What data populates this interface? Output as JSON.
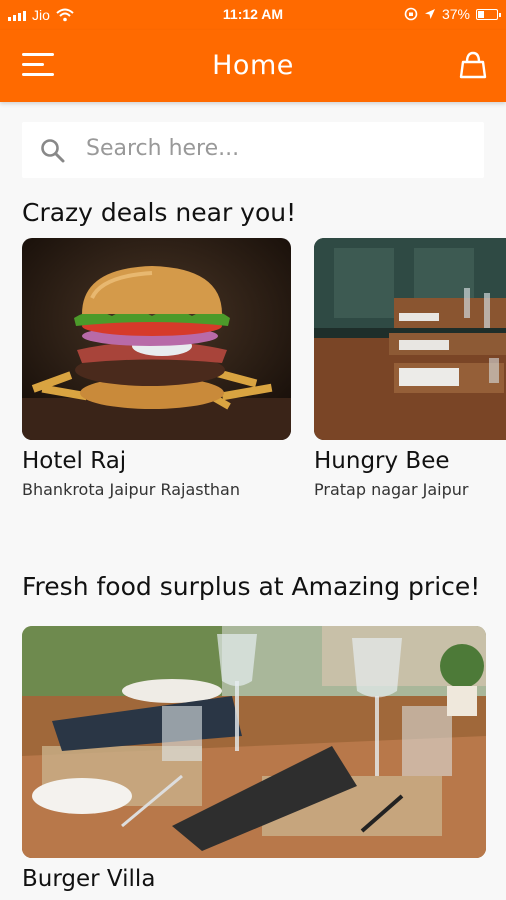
{
  "status": {
    "carrier": "Jio",
    "time": "11:12 AM",
    "battery": "37%",
    "battery_level": 0.37
  },
  "header": {
    "title": "Home",
    "menu_icon": "hamburger-menu-icon",
    "cart_icon": "shopping-bag-icon"
  },
  "search": {
    "placeholder": "Search here..."
  },
  "sections": {
    "deals_title": "Crazy deals near you!",
    "surplus_title": "Fresh food surplus at Amazing price!"
  },
  "deals": [
    {
      "name": "Hotel Raj",
      "address": "Bhankrota Jaipur Rajasthan"
    },
    {
      "name": "Hungry Bee",
      "address": "Pratap nagar Jaipur"
    }
  ],
  "surplus": [
    {
      "name": "Burger Villa"
    }
  ],
  "colors": {
    "brand": "#ff6a00",
    "background": "#f8f8f8"
  }
}
